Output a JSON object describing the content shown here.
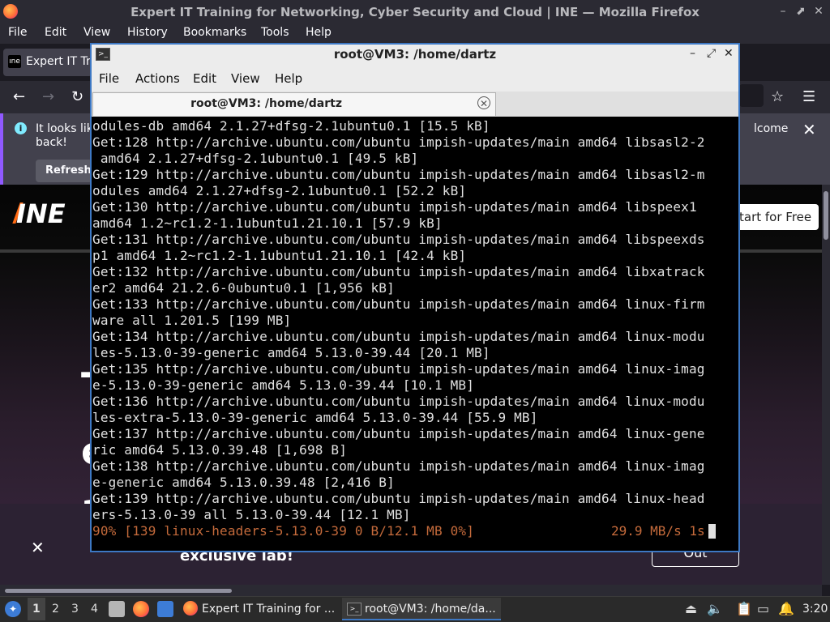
{
  "firefox": {
    "title": "Expert IT Training for Networking, Cyber Security and Cloud | INE — Mozilla Firefox",
    "menu": [
      "File",
      "Edit",
      "View",
      "History",
      "Bookmarks",
      "Tools",
      "Help"
    ],
    "tab_label": "Expert IT Tra",
    "tab_favicon": "ine-favicon",
    "notification": {
      "text_line1": "It looks lik",
      "text_line2": "back!",
      "text_right": "lcome",
      "refresh_label": "Refresh"
    },
    "page": {
      "logo": "INE",
      "start_free_label": "tart for Free",
      "hero_glyphs": [
        "T",
        "e",
        "a"
      ],
      "promo_text": "exclusive lab!",
      "promo_button": "Out"
    }
  },
  "terminal": {
    "title": "root@VM3: /home/dartz",
    "menu": [
      "File",
      "Actions",
      "Edit",
      "View",
      "Help"
    ],
    "tab_label": "root@VM3: /home/dartz",
    "lines": [
      "odules-db amd64 2.1.27+dfsg-2.1ubuntu0.1 [15.5 kB]",
      "Get:128 http://archive.ubuntu.com/ubuntu impish-updates/main amd64 libsasl2-2",
      " amd64 2.1.27+dfsg-2.1ubuntu0.1 [49.5 kB]",
      "Get:129 http://archive.ubuntu.com/ubuntu impish-updates/main amd64 libsasl2-m",
      "odules amd64 2.1.27+dfsg-2.1ubuntu0.1 [52.2 kB]",
      "Get:130 http://archive.ubuntu.com/ubuntu impish-updates/main amd64 libspeex1",
      "amd64 1.2~rc1.2-1.1ubuntu1.21.10.1 [57.9 kB]",
      "Get:131 http://archive.ubuntu.com/ubuntu impish-updates/main amd64 libspeexds",
      "p1 amd64 1.2~rc1.2-1.1ubuntu1.21.10.1 [42.4 kB]",
      "Get:132 http://archive.ubuntu.com/ubuntu impish-updates/main amd64 libxatrack",
      "er2 amd64 21.2.6-0ubuntu0.1 [1,956 kB]",
      "Get:133 http://archive.ubuntu.com/ubuntu impish-updates/main amd64 linux-firm",
      "ware all 1.201.5 [199 MB]",
      "Get:134 http://archive.ubuntu.com/ubuntu impish-updates/main amd64 linux-modu",
      "les-5.13.0-39-generic amd64 5.13.0-39.44 [20.1 MB]",
      "Get:135 http://archive.ubuntu.com/ubuntu impish-updates/main amd64 linux-imag",
      "e-5.13.0-39-generic amd64 5.13.0-39.44 [10.1 MB]",
      "Get:136 http://archive.ubuntu.com/ubuntu impish-updates/main amd64 linux-modu",
      "les-extra-5.13.0-39-generic amd64 5.13.0-39.44 [55.9 MB]",
      "Get:137 http://archive.ubuntu.com/ubuntu impish-updates/main amd64 linux-gene",
      "ric amd64 5.13.0.39.48 [1,698 B]",
      "Get:138 http://archive.ubuntu.com/ubuntu impish-updates/main amd64 linux-imag",
      "e-generic amd64 5.13.0.39.48 [2,416 B]",
      "Get:139 http://archive.ubuntu.com/ubuntu impish-updates/main amd64 linux-head",
      "ers-5.13.0-39 all 5.13.0-39.44 [12.1 MB]"
    ],
    "progress": "90% [139 linux-headers-5.13.0-39 0 B/12.1 MB 0%]",
    "rate": "29.9 MB/s 1s",
    "colors": {
      "progress": "#c46a3b",
      "text": "#e0e0e0",
      "background": "#000000",
      "border": "#3d78c4"
    }
  },
  "taskbar": {
    "workspaces": [
      "1",
      "2",
      "3",
      "4"
    ],
    "tasks": [
      {
        "label": "Expert IT Training for ...",
        "icon": "firefox-icon"
      },
      {
        "label": "root@VM3: /home/da...",
        "icon": "terminal-icon"
      }
    ],
    "clock": "3:20"
  }
}
